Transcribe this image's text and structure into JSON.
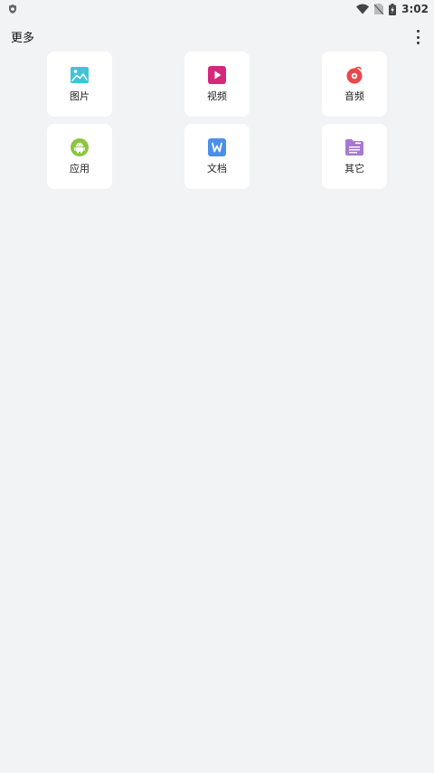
{
  "status_bar": {
    "time": "3:02",
    "icons": [
      "shield-icon",
      "wifi-icon",
      "no-sim-icon",
      "battery-charging-icon"
    ]
  },
  "header": {
    "title": "更多",
    "menu_icon": "more-vertical-icon"
  },
  "categories": [
    {
      "label": "图片",
      "icon": "image-icon",
      "color": "#40c4d8"
    },
    {
      "label": "视频",
      "icon": "video-icon",
      "color": "#d6287a"
    },
    {
      "label": "音频",
      "icon": "music-icon",
      "color": "#e9484c"
    },
    {
      "label": "应用",
      "icon": "android-icon",
      "color": "#8cc63e"
    },
    {
      "label": "文档",
      "icon": "word-doc-icon",
      "color": "#4b8fe8"
    },
    {
      "label": "其它",
      "icon": "folder-other-icon",
      "color": "#a978d0"
    }
  ]
}
